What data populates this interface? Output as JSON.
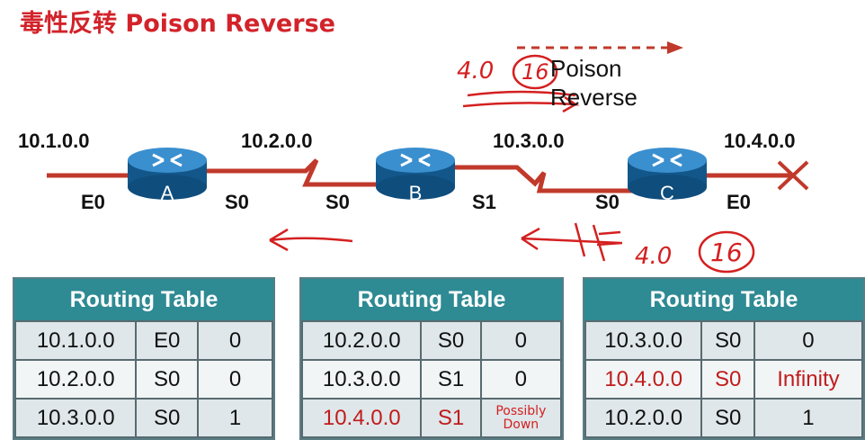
{
  "title": "毒性反转 Poison Reverse",
  "networks": [
    "10.1.0.0",
    "10.2.0.0",
    "10.3.0.0",
    "10.4.0.0"
  ],
  "routers": [
    {
      "name": "A",
      "left_iface": "E0",
      "right_iface": "S0"
    },
    {
      "name": "B",
      "left_iface": "S0",
      "right_iface": "S1"
    },
    {
      "name": "C",
      "left_iface": "S0",
      "right_iface": "E0"
    }
  ],
  "poison_reverse_label": {
    "line1": "Poison",
    "line2": "Reverse"
  },
  "annotations": {
    "upper_metric": "4.0",
    "upper_circled": "16",
    "lower_metric": "4.0",
    "lower_circled": "16",
    "possibly_down": {
      "line1": "Possibly",
      "line2": "Down"
    }
  },
  "colors": {
    "title": "#d2232a",
    "link": "#c0392b",
    "router": "#1b6fa8",
    "table_header": "#2e8a93",
    "highlight": "#c01c1c",
    "ink": "#d42020"
  },
  "tables": [
    {
      "header": "Routing Table",
      "rows": [
        {
          "network": "10.1.0.0",
          "iface": "E0",
          "metric": "0",
          "highlight": false
        },
        {
          "network": "10.2.0.0",
          "iface": "S0",
          "metric": "0",
          "highlight": false
        },
        {
          "network": "10.3.0.0",
          "iface": "S0",
          "metric": "1",
          "highlight": false
        }
      ]
    },
    {
      "header": "Routing Table",
      "rows": [
        {
          "network": "10.2.0.0",
          "iface": "S0",
          "metric": "0",
          "highlight": false
        },
        {
          "network": "10.3.0.0",
          "iface": "S1",
          "metric": "0",
          "highlight": false
        },
        {
          "network": "10.4.0.0",
          "iface": "S1",
          "metric": "",
          "highlight": true
        }
      ]
    },
    {
      "header": "Routing Table",
      "rows": [
        {
          "network": "10.3.0.0",
          "iface": "S0",
          "metric": "0",
          "highlight": false
        },
        {
          "network": "10.4.0.0",
          "iface": "S0",
          "metric": "Infinity",
          "highlight": true
        },
        {
          "network": "10.2.0.0",
          "iface": "S0",
          "metric": "1",
          "highlight": false
        }
      ]
    }
  ]
}
